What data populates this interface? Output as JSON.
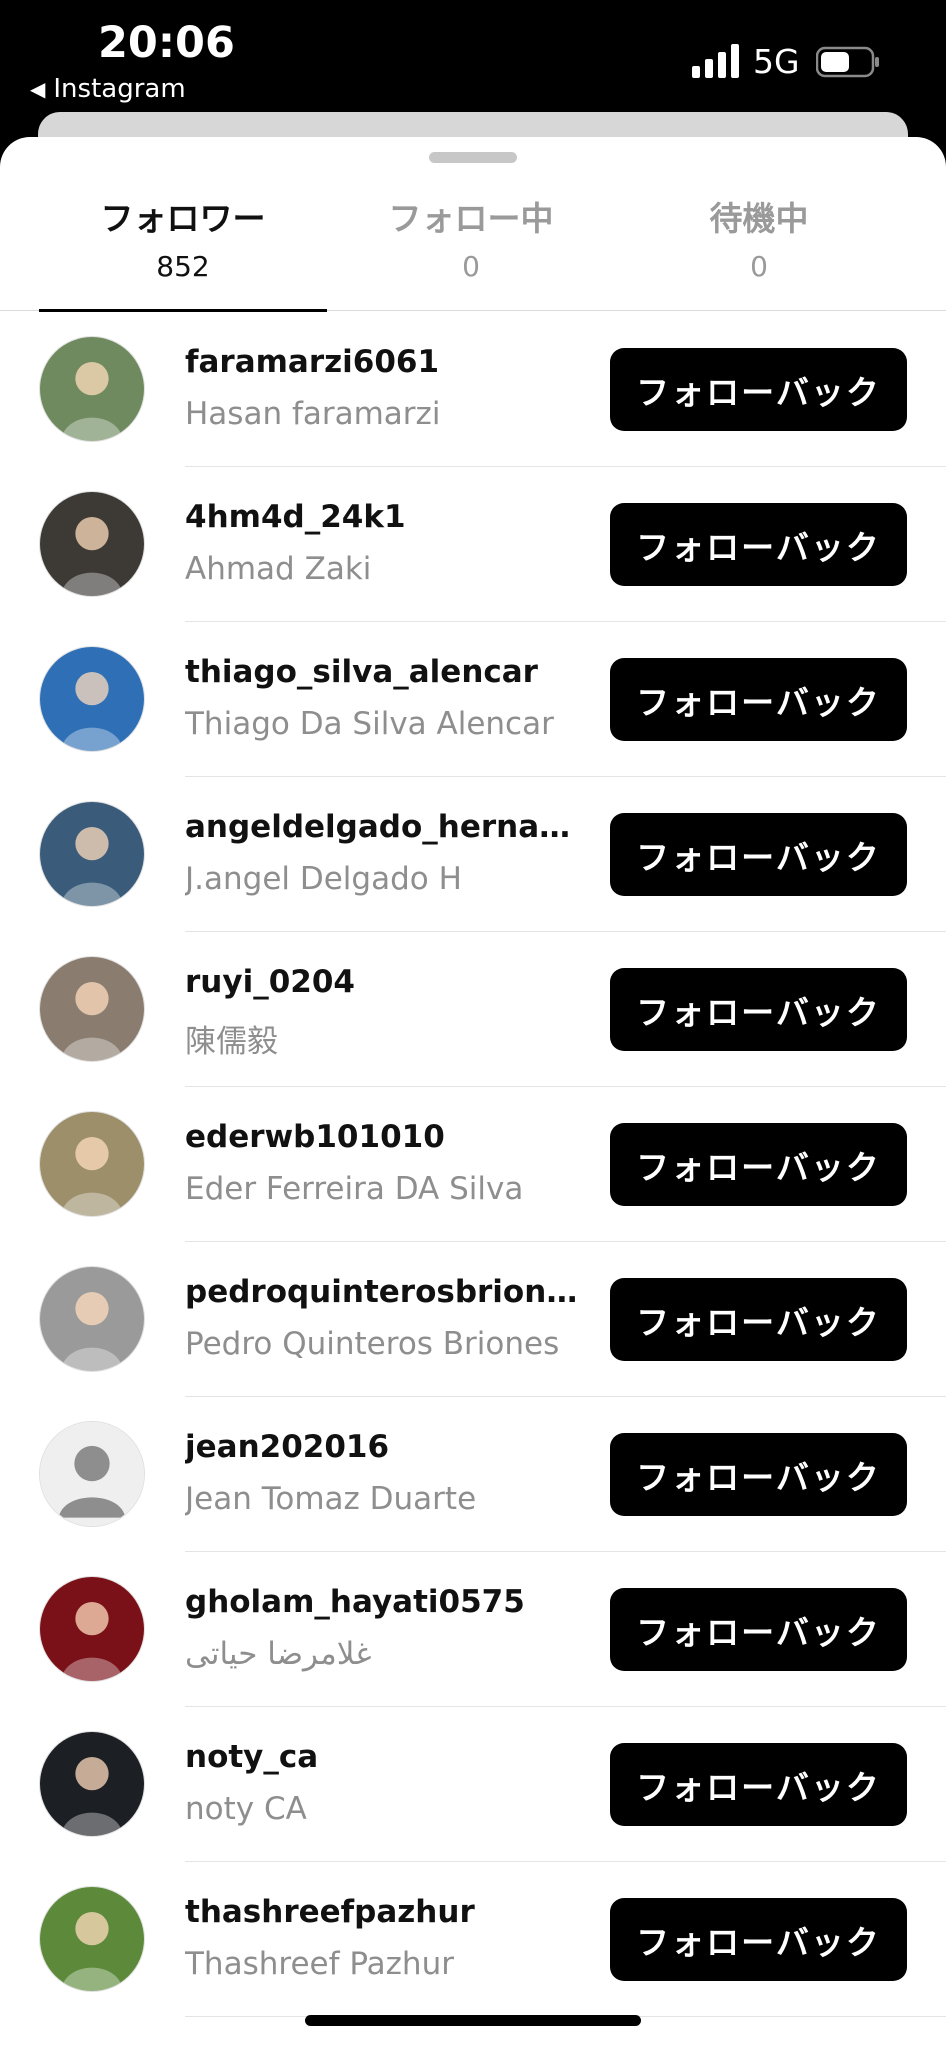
{
  "status_bar": {
    "time": "20:06",
    "back_app": "Instagram",
    "back_icon": "back-triangle-icon",
    "network": "5G"
  },
  "tabs": [
    {
      "title": "フォロワー",
      "count": "852",
      "active": true
    },
    {
      "title": "フォロー中",
      "count": "0",
      "active": false
    },
    {
      "title": "待機中",
      "count": "0",
      "active": false
    }
  ],
  "followers": [
    {
      "username": "faramarzi6061",
      "full_name": "Hasan faramarzi",
      "button": "フォローバック",
      "avatar_color": "#6f8a5e"
    },
    {
      "username": "4hm4d_24k1",
      "full_name": "Ahmad Zaki",
      "button": "フォローバック",
      "avatar_color": "#3d3a36"
    },
    {
      "username": "thiago_silva_alencar",
      "full_name": "Thiago Da Silva Alencar",
      "button": "フォローバック",
      "avatar_color": "#2f6fb6"
    },
    {
      "username": "angeldelgado_hernan...",
      "full_name": "J.angel Delgado H",
      "button": "フォローバック",
      "avatar_color": "#3a5c7a"
    },
    {
      "username": "ruyi_0204",
      "full_name": "陳儒毅",
      "button": "フォローバック",
      "avatar_color": "#8a7d70"
    },
    {
      "username": "ederwb101010",
      "full_name": "Eder Ferreira DA Silva",
      "button": "フォローバック",
      "avatar_color": "#9c8f6a"
    },
    {
      "username": "pedroquinterosbriones",
      "full_name": "Pedro Quinteros Briones",
      "button": "フォローバック",
      "avatar_color": "#9a9a9a"
    },
    {
      "username": "jean202016",
      "full_name": "Jean Tomaz Duarte",
      "button": "フォローバック",
      "avatar_color": "default"
    },
    {
      "username": "gholam_hayati0575",
      "full_name": "غلامرضا حیاتی",
      "button": "フォローバック",
      "avatar_color": "#7a1018"
    },
    {
      "username": "noty_ca",
      "full_name": "noty CA",
      "button": "フォローバック",
      "avatar_color": "#1c1f24"
    },
    {
      "username": "thashreefpazhur",
      "full_name": "Thashreef Pazhur",
      "button": "フォローバック",
      "avatar_color": "#5d8a3a"
    }
  ]
}
